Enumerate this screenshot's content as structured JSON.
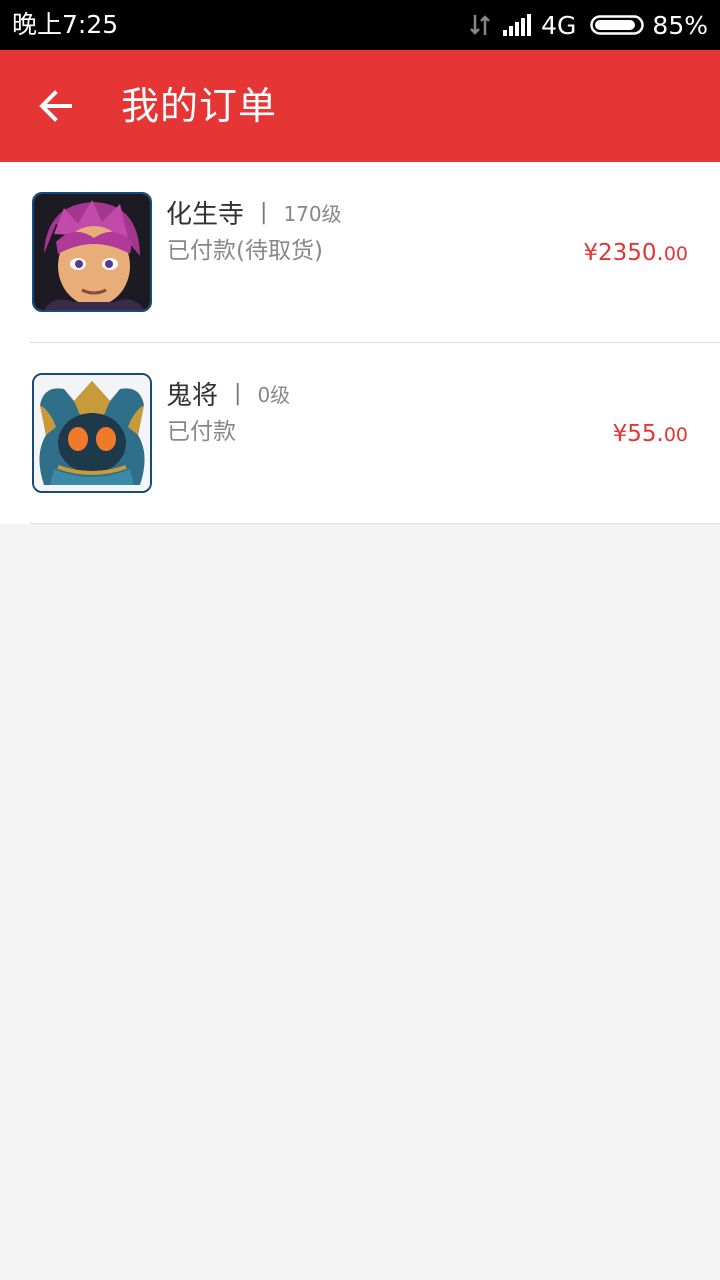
{
  "status_bar": {
    "time": "晚上7:25",
    "network": "4G",
    "battery": "85%"
  },
  "app_bar": {
    "title": "我的订单"
  },
  "orders": [
    {
      "name": "化生寺",
      "separator": "|",
      "level": "170级",
      "status": "已付款(待取货)",
      "price_main": "¥2350.",
      "price_cents": "00",
      "avatar_icon": "hua-sheng-si-character-avatar"
    },
    {
      "name": "鬼将",
      "separator": "|",
      "level": "0级",
      "status": "已付款",
      "price_main": "¥55.",
      "price_cents": "00",
      "avatar_icon": "gui-jiang-character-avatar"
    }
  ],
  "colors": {
    "accent": "#e63535",
    "background": "#f3f3f3",
    "status_bar": "#000000"
  }
}
